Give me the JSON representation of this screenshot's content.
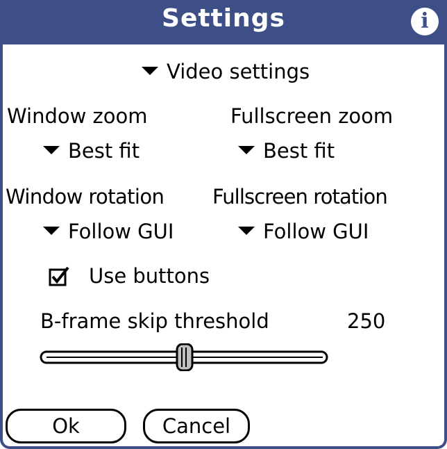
{
  "title": "Settings",
  "info_icon": "info-icon",
  "section_selector": "Video settings",
  "window_zoom": {
    "label": "Window zoom",
    "value": "Best fit"
  },
  "fullscreen_zoom": {
    "label": "Fullscreen zoom",
    "value": "Best fit"
  },
  "window_rotation": {
    "label": "Window rotation",
    "value": "Follow GUI"
  },
  "fullscreen_rotation": {
    "label": "Fullscreen rotation",
    "value": "Follow GUI"
  },
  "use_buttons": {
    "label": "Use buttons",
    "checked": true
  },
  "bframe": {
    "label": "B-frame skip threshold",
    "value": "250",
    "slider_fraction": 0.5
  },
  "buttons": {
    "ok": "Ok",
    "cancel": "Cancel"
  },
  "colors": {
    "titlebar": "#3d4f86",
    "background": "#ffffff",
    "text": "#000000"
  }
}
